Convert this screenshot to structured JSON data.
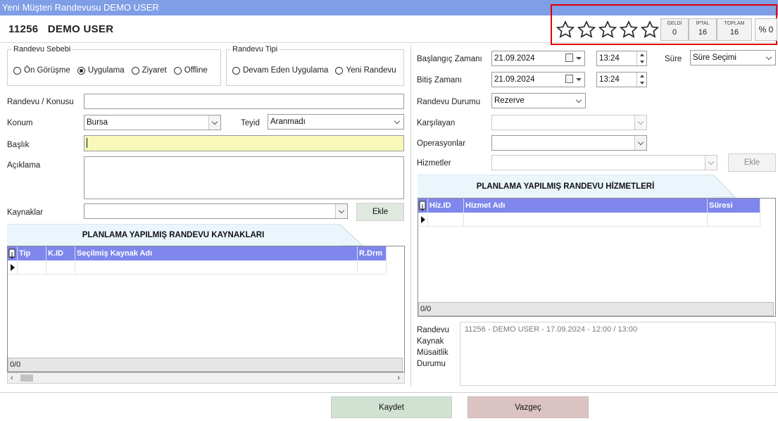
{
  "window": {
    "title": "Yeni Müşteri Randevusu DEMO USER"
  },
  "customer": {
    "id": "11256",
    "name": "DEMO USER"
  },
  "rating": {
    "stars": 0,
    "max": 5
  },
  "stats": [
    {
      "label": "GELDİ",
      "value": "0"
    },
    {
      "label": "İPTAL",
      "value": "16"
    },
    {
      "label": "TOPLAM",
      "value": "16"
    }
  ],
  "stats_percent": "% 0",
  "reason": {
    "legend": "Randevu Sebebi",
    "options": [
      "Ön Görüşme",
      "Uygulama",
      "Ziyaret",
      "Offline"
    ],
    "selected": "Uygulama"
  },
  "type": {
    "legend": "Randevu Tipi",
    "options": [
      "Devam Eden Uygulama",
      "Yeni Randevu"
    ],
    "selected": ""
  },
  "form": {
    "subject_label": "Randevu / Konusu",
    "subject_value": "",
    "location_label": "Konum",
    "location_value": "Bursa",
    "confirm_label": "Teyid",
    "confirm_value": "Aranmadı",
    "title_label": "Başlık",
    "title_value": "",
    "desc_label": "Açıklama",
    "desc_value": "",
    "resources_label": "Kaynaklar",
    "resources_value": "",
    "add_label": "Ekle"
  },
  "resources_grid": {
    "title": "PLANLAMA YAPILMIŞ RANDEVU KAYNAKLARI",
    "columns": [
      "Tip",
      "K.ID",
      "Seçilmiş Kaynak Adı",
      "R.Drm"
    ],
    "footer": "0/0"
  },
  "schedule": {
    "start_label": "Başlangıç Zamanı",
    "start_date": "21.09.2024",
    "start_time": "13:24",
    "end_label": "Bitiş Zamanı",
    "end_date": "21.09.2024",
    "end_time": "13:24",
    "duration_label": "Süre",
    "duration_value": "Süre Seçimi",
    "status_label": "Randevu Durumu",
    "status_value": "Rezerve",
    "host_label": "Karşılayan",
    "host_value": "",
    "ops_label": "Operasyonlar",
    "ops_value": "",
    "services_label": "Hizmetler",
    "services_value": "",
    "services_add": "Ekle"
  },
  "services_grid": {
    "title": "PLANLAMA YAPILMIŞ RANDEVU HİZMETLERİ",
    "columns": [
      "Hiz.ID",
      "Hizmet Adı",
      "Süresi"
    ],
    "footer": "0/0"
  },
  "availability": {
    "label_lines": [
      "Randevu",
      "Kaynak",
      "Müsaitlik",
      "Durumu"
    ],
    "text": "11256 - DEMO USER - 17.09.2024 - 12:00 / 13:00"
  },
  "actions": {
    "save": "Kaydet",
    "cancel": "Vazgeç"
  },
  "colors": {
    "titlebar": "#7f9ee6",
    "grid_header": "#7f86ec",
    "title_input": "#f7f8ba",
    "save_bg": "#d1e2d2",
    "cancel_bg": "#dcc3c3",
    "highlight": "#e00000"
  }
}
